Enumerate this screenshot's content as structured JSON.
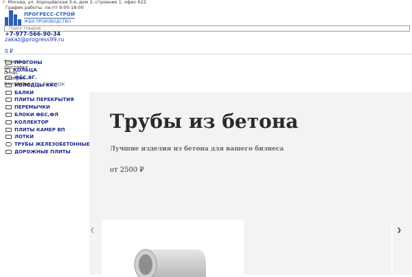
{
  "header": {
    "address": "г. Москва, ул. Хорошёвская 3-я, дом 2, строение 1, офис 622.",
    "schedule": "График работы: пн-пт 9:00-18:00",
    "logo_name": "ПРОГРЕСС-СТРОЙ",
    "logo_sub": "ЖБИ ПРОИЗВОДСТВО",
    "search_placeholder": "Поиск товаров",
    "phone": "+7-977-566-90-34",
    "email": "zakaz@progress99.ru",
    "cart_total": "0 ₽",
    "callback": "ЗАКАЗАТЬ ЗВОНОК"
  },
  "ghost_menu": [
    "Главная",
    "Доставка",
    "О нас",
    "Галерея",
    "Контакты"
  ],
  "sidebar": {
    "items": [
      {
        "label": "ПРОГОНЫ"
      },
      {
        "label": "КОЛЬЦА"
      },
      {
        "label": "ФБС,ВГ."
      },
      {
        "label": "КОЛОДЦЫ ККС"
      },
      {
        "label": "БАЛКИ"
      },
      {
        "label": "ПЛИТЫ ПЕРЕКРЫТИЯ"
      },
      {
        "label": "ПЕРЕМЫЧКИ"
      },
      {
        "label": "БЛОКИ ФБС,ФЛ"
      },
      {
        "label": "КОЛЛЕКТОР"
      },
      {
        "label": "ПЛИТЫ КАМЕР ВП"
      },
      {
        "label": "ЛОТКИ"
      },
      {
        "label": "ТРУБЫ ЖЕЛЕЗОБЕТОННЫЕ"
      },
      {
        "label": "ДОРОЖНЫЕ ПЛИТЫ"
      }
    ]
  },
  "hero": {
    "title": "Трубы из бетона",
    "subtitle": "Лучшие изделия из бетона для вашего бизнеса",
    "price": "от 2500 ₽"
  },
  "icons": {
    "prev": "chevron-left-icon",
    "next": "chevron-right-icon"
  },
  "colors": {
    "brand": "#2b5fb0",
    "menu_text": "#1a2a8a",
    "hero_bg": "#f3f3f3"
  }
}
